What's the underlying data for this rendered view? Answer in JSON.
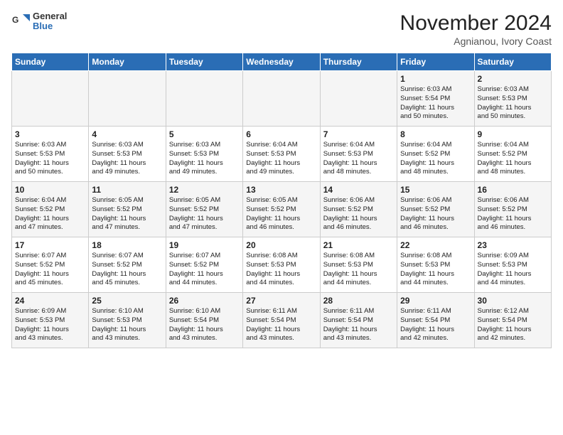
{
  "header": {
    "logo_line1": "General",
    "logo_line2": "Blue",
    "title": "November 2024",
    "subtitle": "Agnianou, Ivory Coast"
  },
  "days_of_week": [
    "Sunday",
    "Monday",
    "Tuesday",
    "Wednesday",
    "Thursday",
    "Friday",
    "Saturday"
  ],
  "weeks": [
    [
      {
        "day": "",
        "content": ""
      },
      {
        "day": "",
        "content": ""
      },
      {
        "day": "",
        "content": ""
      },
      {
        "day": "",
        "content": ""
      },
      {
        "day": "",
        "content": ""
      },
      {
        "day": "1",
        "content": "Sunrise: 6:03 AM\nSunset: 5:54 PM\nDaylight: 11 hours\nand 50 minutes."
      },
      {
        "day": "2",
        "content": "Sunrise: 6:03 AM\nSunset: 5:53 PM\nDaylight: 11 hours\nand 50 minutes."
      }
    ],
    [
      {
        "day": "3",
        "content": "Sunrise: 6:03 AM\nSunset: 5:53 PM\nDaylight: 11 hours\nand 50 minutes."
      },
      {
        "day": "4",
        "content": "Sunrise: 6:03 AM\nSunset: 5:53 PM\nDaylight: 11 hours\nand 49 minutes."
      },
      {
        "day": "5",
        "content": "Sunrise: 6:03 AM\nSunset: 5:53 PM\nDaylight: 11 hours\nand 49 minutes."
      },
      {
        "day": "6",
        "content": "Sunrise: 6:04 AM\nSunset: 5:53 PM\nDaylight: 11 hours\nand 49 minutes."
      },
      {
        "day": "7",
        "content": "Sunrise: 6:04 AM\nSunset: 5:53 PM\nDaylight: 11 hours\nand 48 minutes."
      },
      {
        "day": "8",
        "content": "Sunrise: 6:04 AM\nSunset: 5:52 PM\nDaylight: 11 hours\nand 48 minutes."
      },
      {
        "day": "9",
        "content": "Sunrise: 6:04 AM\nSunset: 5:52 PM\nDaylight: 11 hours\nand 48 minutes."
      }
    ],
    [
      {
        "day": "10",
        "content": "Sunrise: 6:04 AM\nSunset: 5:52 PM\nDaylight: 11 hours\nand 47 minutes."
      },
      {
        "day": "11",
        "content": "Sunrise: 6:05 AM\nSunset: 5:52 PM\nDaylight: 11 hours\nand 47 minutes."
      },
      {
        "day": "12",
        "content": "Sunrise: 6:05 AM\nSunset: 5:52 PM\nDaylight: 11 hours\nand 47 minutes."
      },
      {
        "day": "13",
        "content": "Sunrise: 6:05 AM\nSunset: 5:52 PM\nDaylight: 11 hours\nand 46 minutes."
      },
      {
        "day": "14",
        "content": "Sunrise: 6:06 AM\nSunset: 5:52 PM\nDaylight: 11 hours\nand 46 minutes."
      },
      {
        "day": "15",
        "content": "Sunrise: 6:06 AM\nSunset: 5:52 PM\nDaylight: 11 hours\nand 46 minutes."
      },
      {
        "day": "16",
        "content": "Sunrise: 6:06 AM\nSunset: 5:52 PM\nDaylight: 11 hours\nand 46 minutes."
      }
    ],
    [
      {
        "day": "17",
        "content": "Sunrise: 6:07 AM\nSunset: 5:52 PM\nDaylight: 11 hours\nand 45 minutes."
      },
      {
        "day": "18",
        "content": "Sunrise: 6:07 AM\nSunset: 5:52 PM\nDaylight: 11 hours\nand 45 minutes."
      },
      {
        "day": "19",
        "content": "Sunrise: 6:07 AM\nSunset: 5:52 PM\nDaylight: 11 hours\nand 44 minutes."
      },
      {
        "day": "20",
        "content": "Sunrise: 6:08 AM\nSunset: 5:53 PM\nDaylight: 11 hours\nand 44 minutes."
      },
      {
        "day": "21",
        "content": "Sunrise: 6:08 AM\nSunset: 5:53 PM\nDaylight: 11 hours\nand 44 minutes."
      },
      {
        "day": "22",
        "content": "Sunrise: 6:08 AM\nSunset: 5:53 PM\nDaylight: 11 hours\nand 44 minutes."
      },
      {
        "day": "23",
        "content": "Sunrise: 6:09 AM\nSunset: 5:53 PM\nDaylight: 11 hours\nand 44 minutes."
      }
    ],
    [
      {
        "day": "24",
        "content": "Sunrise: 6:09 AM\nSunset: 5:53 PM\nDaylight: 11 hours\nand 43 minutes."
      },
      {
        "day": "25",
        "content": "Sunrise: 6:10 AM\nSunset: 5:53 PM\nDaylight: 11 hours\nand 43 minutes."
      },
      {
        "day": "26",
        "content": "Sunrise: 6:10 AM\nSunset: 5:54 PM\nDaylight: 11 hours\nand 43 minutes."
      },
      {
        "day": "27",
        "content": "Sunrise: 6:11 AM\nSunset: 5:54 PM\nDaylight: 11 hours\nand 43 minutes."
      },
      {
        "day": "28",
        "content": "Sunrise: 6:11 AM\nSunset: 5:54 PM\nDaylight: 11 hours\nand 43 minutes."
      },
      {
        "day": "29",
        "content": "Sunrise: 6:11 AM\nSunset: 5:54 PM\nDaylight: 11 hours\nand 42 minutes."
      },
      {
        "day": "30",
        "content": "Sunrise: 6:12 AM\nSunset: 5:54 PM\nDaylight: 11 hours\nand 42 minutes."
      }
    ]
  ]
}
